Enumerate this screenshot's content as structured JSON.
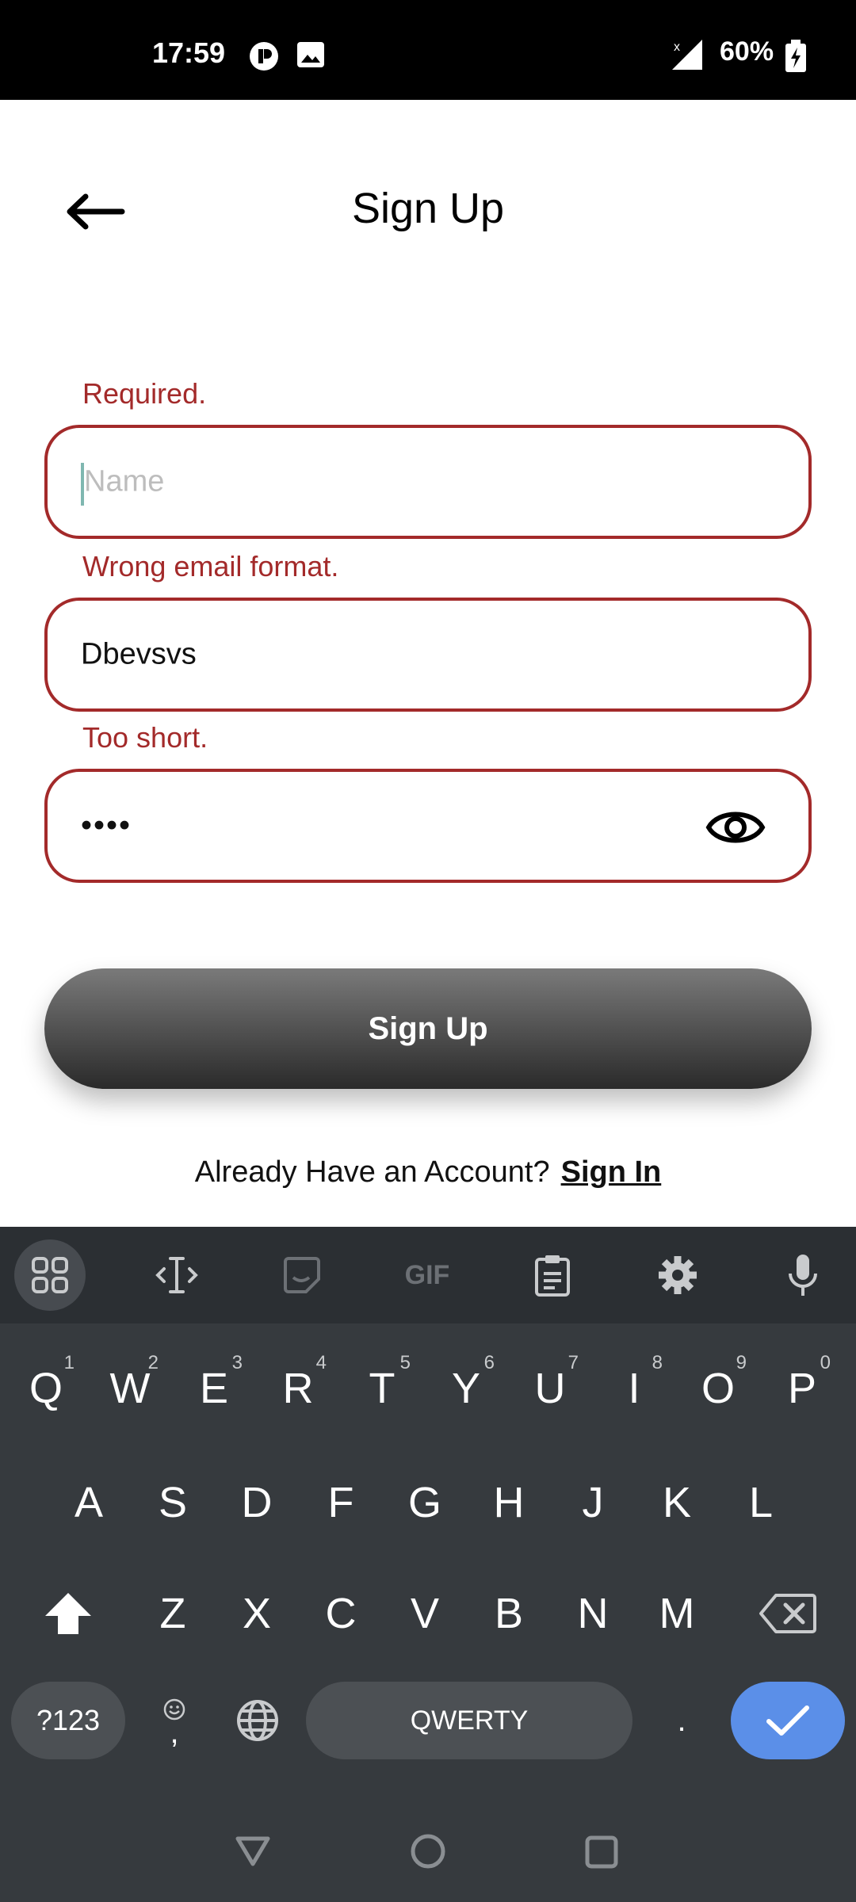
{
  "status_bar": {
    "time": "17:59",
    "battery": "60%"
  },
  "header": {
    "title": "Sign Up"
  },
  "form": {
    "name_error": "Required.",
    "name_placeholder": "Name",
    "email_error": "Wrong email format.",
    "email_value": "Dbevsvs",
    "password_error": "Too short.",
    "password_value": "••••"
  },
  "signup_button": "Sign Up",
  "signin": {
    "prompt": "Already Have an Account?",
    "link": "Sign In"
  },
  "keyboard": {
    "toolbar": {
      "gif": "GIF"
    },
    "row1": [
      {
        "label": "Q",
        "hint": "1"
      },
      {
        "label": "W",
        "hint": "2"
      },
      {
        "label": "E",
        "hint": "3"
      },
      {
        "label": "R",
        "hint": "4"
      },
      {
        "label": "T",
        "hint": "5"
      },
      {
        "label": "Y",
        "hint": "6"
      },
      {
        "label": "U",
        "hint": "7"
      },
      {
        "label": "I",
        "hint": "8"
      },
      {
        "label": "O",
        "hint": "9"
      },
      {
        "label": "P",
        "hint": "0"
      }
    ],
    "row2": [
      "A",
      "S",
      "D",
      "F",
      "G",
      "H",
      "J",
      "K",
      "L"
    ],
    "row3": [
      "Z",
      "X",
      "C",
      "V",
      "B",
      "N",
      "M"
    ],
    "symbols_key": "?123",
    "comma_key": ",",
    "space_key": "QWERTY",
    "period_key": "."
  },
  "colors": {
    "error": "#a32a2a",
    "keyboard_bg": "#363a3e",
    "enter_key": "#5b8fe8"
  }
}
